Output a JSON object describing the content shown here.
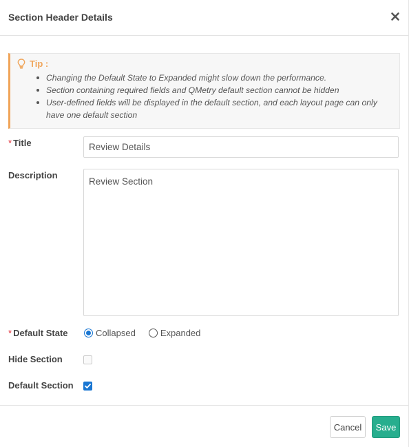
{
  "dialog": {
    "title": "Section Header Details"
  },
  "tip": {
    "label": "Tip :",
    "items": [
      "Changing the Default State to Expanded might slow down the performance.",
      "Section containing required fields and QMetry default section cannot be hidden",
      "User-defined fields will be displayed in the default section, and each layout page can only have one default section"
    ]
  },
  "form": {
    "required_mark": "*",
    "title_label": "Title",
    "title_value": "Review Details",
    "description_label": "Description",
    "description_value": "Review Section",
    "default_state_label": "Default State",
    "default_state_options": [
      "Collapsed",
      "Expanded"
    ],
    "default_state_selected": "Collapsed",
    "hide_section_label": "Hide Section",
    "hide_section_checked": false,
    "default_section_label": "Default Section",
    "default_section_checked": true
  },
  "footer": {
    "cancel_label": "Cancel",
    "save_label": "Save"
  },
  "colors": {
    "tip_accent": "#f0a55a",
    "required": "#e0262f",
    "selected": "#1976d2",
    "save_button": "#27ae8e"
  },
  "icons": {
    "close": "close-icon",
    "tip": "lightbulb-icon",
    "check": "checkmark-icon"
  }
}
